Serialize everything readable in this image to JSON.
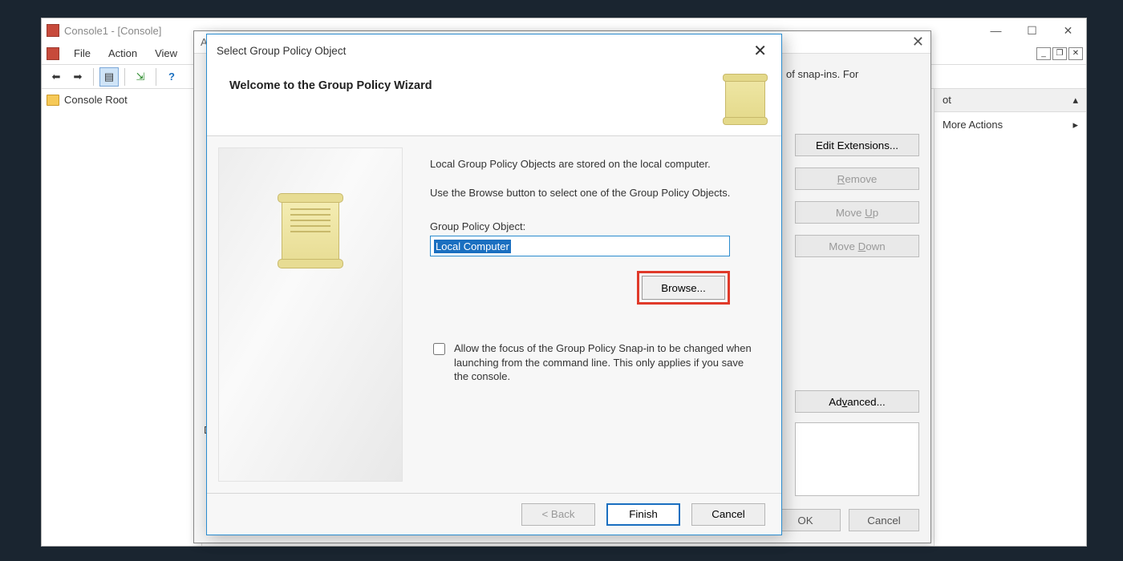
{
  "mmc": {
    "title": "Console1 - [Console]",
    "menus": {
      "file": "File",
      "action": "Action",
      "view": "View"
    },
    "tree_root": "Console Root"
  },
  "actions_pane": {
    "header_suffix": "ot",
    "more": "More Actions"
  },
  "snapin": {
    "title": "Add or Remove Snap-ins",
    "frag_text": "of snap-ins. For",
    "buttons": {
      "edit_ext": "Edit Extensions...",
      "remove": "Remove",
      "move_up": "Move Up",
      "move_down": "Move Down",
      "advanced": "Advanced...",
      "ok": "OK",
      "cancel": "Cancel"
    },
    "desc_label": "D"
  },
  "wizard": {
    "title": "Select Group Policy Object",
    "heading": "Welcome to the Group Policy Wizard",
    "p1": "Local Group Policy Objects are stored on the local computer.",
    "p2": "Use the Browse button to select one of the Group Policy Objects.",
    "gpo_label": "Group Policy Object:",
    "gpo_value": "Local Computer",
    "browse": "Browse...",
    "checkbox": "Allow the focus of the Group Policy Snap-in to be changed when launching from the command line.  This only applies if you save the console.",
    "back": "< Back",
    "finish": "Finish",
    "cancel": "Cancel"
  }
}
